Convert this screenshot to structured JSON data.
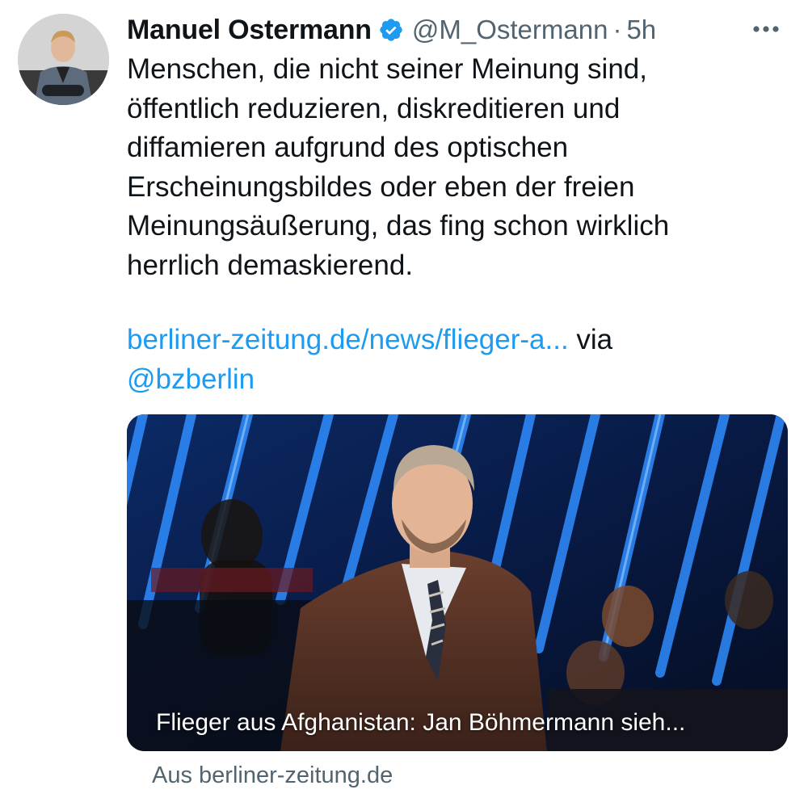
{
  "author": {
    "display_name": "Manuel Ostermann",
    "handle": "@M_Ostermann",
    "separator": "·",
    "time": "5h",
    "verified": true
  },
  "tweet": {
    "text": "Menschen, die nicht seiner Meinung sind,\nöffentlich reduzieren, diskreditieren und\ndiffamieren aufgrund des optischen\nErscheinungsbildes oder eben der freien\nMeinungsäußerung, das fing schon wirklich\nherrlich demaskierend.",
    "link_text": "berliner-zeitung.de/news/flieger-a...",
    "via_text": " via ",
    "mention": "@bzberlin"
  },
  "card": {
    "title": "Flieger aus Afghanistan: Jan Böhmermann sieh...",
    "domain": "Aus berliner-zeitung.de"
  },
  "icons": {
    "verified": "verified-badge-icon",
    "more": "more-options-icon"
  },
  "colors": {
    "link": "#1d9bf0",
    "secondary_text": "#536471",
    "verified": "#1d9bf0"
  }
}
